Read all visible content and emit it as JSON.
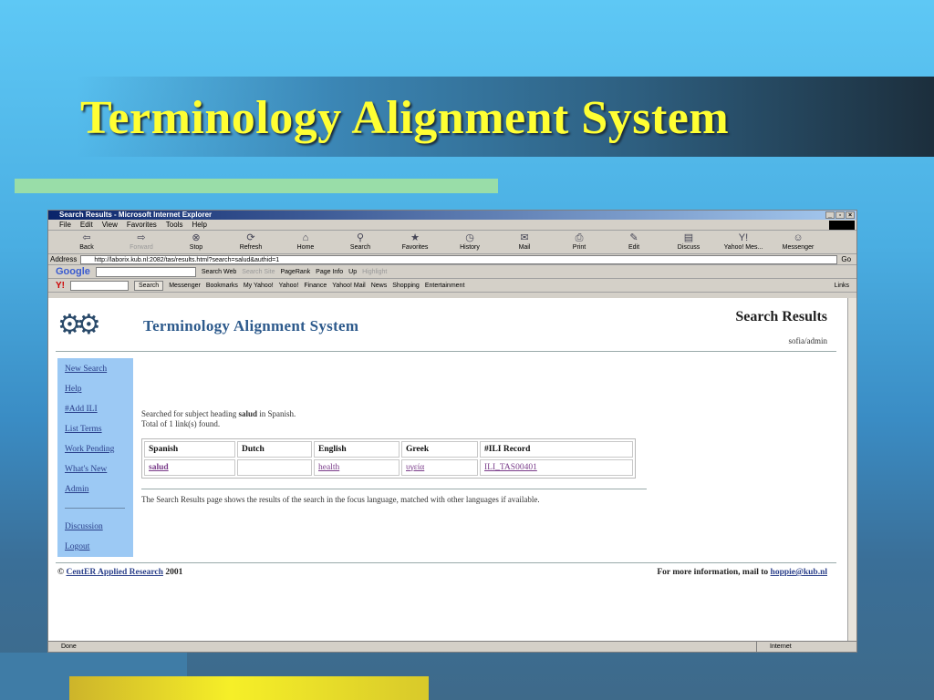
{
  "slide": {
    "title": "Terminology Alignment System"
  },
  "browser": {
    "window_title": "Search Results - Microsoft Internet Explorer",
    "menu": [
      "File",
      "Edit",
      "View",
      "Favorites",
      "Tools",
      "Help"
    ],
    "toolbar": [
      "Back",
      "Forward",
      "Stop",
      "Refresh",
      "Home",
      "Search",
      "Favorites",
      "History",
      "Mail",
      "Print",
      "Edit",
      "Discuss",
      "Yahoo! Mes...",
      "Messenger"
    ],
    "address_label": "Address",
    "address_url": "http://laborix.kub.nl:2082/tas/results.html?search=salud&authid=1",
    "go_label": "Go",
    "google_bar": {
      "logo": "Google",
      "search_web": "Search Web",
      "search_site": "Search Site",
      "pagerank": "PageRank",
      "page_info": "Page Info",
      "up": "Up",
      "highlight": "Highlight"
    },
    "yahoo_bar": {
      "search_btn": "Search",
      "items": [
        "Messenger",
        "Bookmarks",
        "My Yahoo!",
        "Yahoo!",
        "Finance",
        "Yahoo! Mail",
        "News",
        "Shopping",
        "Entertainment"
      ],
      "links": "Links"
    },
    "status_left": "Done",
    "status_zone": "Internet"
  },
  "page": {
    "app_title": "Terminology Alignment System",
    "heading": "Search Results",
    "user": "sofia/admin",
    "nav": [
      "New Search",
      "Help",
      "#Add ILI",
      "List Terms",
      "Work Pending",
      "What's New",
      "Admin"
    ],
    "nav_bottom": [
      "Discussion",
      "Logout"
    ],
    "search_text_before": "Searched for subject heading ",
    "search_term": "salud",
    "search_text_after": " in Spanish.",
    "total_found": "Total of 1 link(s) found.",
    "table": {
      "headers": [
        "Spanish",
        "Dutch",
        "English",
        "Greek",
        "#ILI Record"
      ],
      "row": [
        "salud",
        "",
        "health",
        "υγεία",
        "ILI_TAS00401"
      ]
    },
    "description": "The Search Results page shows the results of the search in the focus language, matched with other languages if available.",
    "footer_copy": "©",
    "footer_org": "CentER Applied Research",
    "footer_year": "2001",
    "footer_contact": "For more information, mail to ",
    "footer_email": "hoppie@kub.nl"
  }
}
